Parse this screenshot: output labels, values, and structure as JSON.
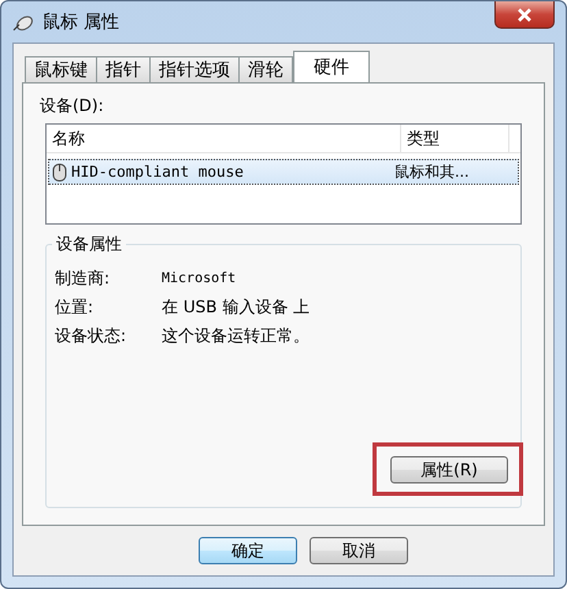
{
  "window": {
    "title": "鼠标 属性"
  },
  "tabs": [
    {
      "label": "鼠标键",
      "selected": false
    },
    {
      "label": "指针",
      "selected": false
    },
    {
      "label": "指针选项",
      "selected": false
    },
    {
      "label": "滑轮",
      "selected": false
    },
    {
      "label": "硬件",
      "selected": true
    }
  ],
  "devices": {
    "label": "设备(D):",
    "columns": [
      "名称",
      "类型"
    ],
    "rows": [
      {
        "name": "HID-compliant mouse",
        "type": "鼠标和其...",
        "selected": true
      }
    ]
  },
  "device_properties": {
    "title": "设备属性",
    "fields": [
      {
        "label": "制造商:",
        "value": "Microsoft"
      },
      {
        "label": "位置:",
        "value": "在 USB 输入设备 上"
      },
      {
        "label": "设备状态:",
        "value": "这个设备运转正常。"
      }
    ],
    "button": "属性(R)"
  },
  "buttons": [
    "确定",
    "取消"
  ]
}
